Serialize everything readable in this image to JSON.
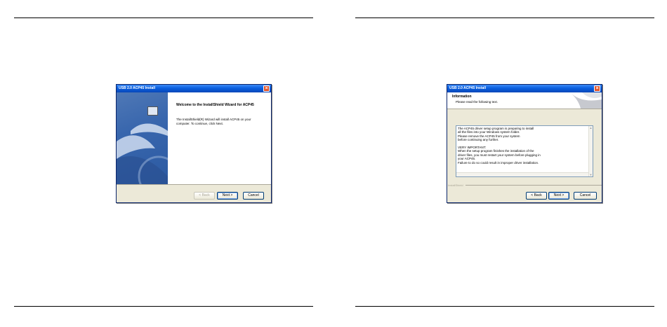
{
  "left_window": {
    "title": "USB 2.0 ACP45 Install",
    "heading": "Welcome to the InstallShield Wizard for ACP45",
    "body": "The InstallShield(R) Wizard will install ACP45 on your computer. To continue, click Next.",
    "buttons": {
      "back": "Back",
      "next": "Next",
      "cancel": "Cancel"
    }
  },
  "right_window": {
    "title": "USB 2.0 ACP45 Install",
    "header_title": "Information",
    "header_subtitle": "Please read the following text.",
    "text_lines": [
      "The ACP45 driver setup program is preparing to install",
      "all the files into your Windows system folder.",
      "Please remove the ACP45 from your system",
      "before continuing any further.",
      "",
      "VERY IMPORTANT:",
      "When the setup program finishes the installation of the",
      "driver files, you must restart your system before plugging in",
      "your ACP45.",
      "Failure to do so could result in improper driver installation."
    ],
    "footer_label": "InstallShield",
    "buttons": {
      "back": "Back",
      "next": "Next",
      "cancel": "Cancel"
    }
  },
  "colors": {
    "titlebar": "#0a5fe0",
    "dialog_bg": "#ece9d8",
    "side_panel": "#3866ad"
  },
  "icons": [
    "close-icon",
    "computer-icon",
    "wizard-graphic",
    "scroll-up-icon",
    "scroll-down-icon"
  ]
}
